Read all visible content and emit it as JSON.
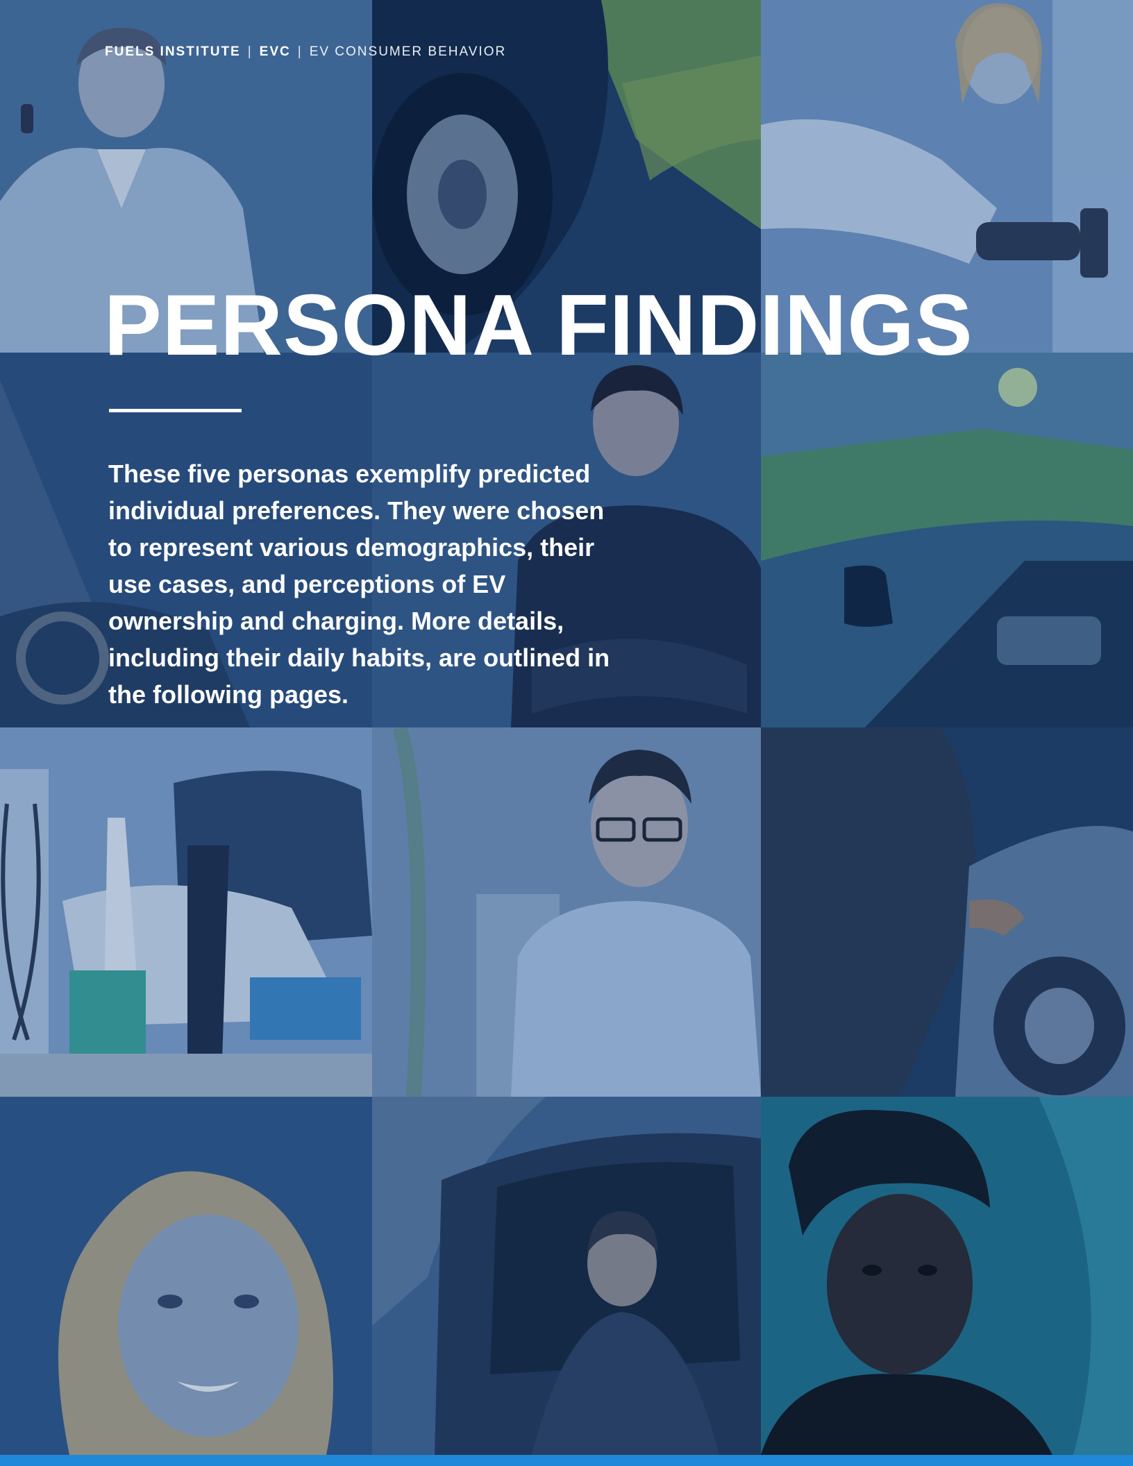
{
  "header": {
    "org": "FUELS INSTITUTE",
    "separator": "|",
    "program": "EVC",
    "section": "EV CONSUMER BEHAVIOR"
  },
  "title": "PERSONA FINDINGS",
  "intro": "These five personas exemplify predicted individual preferences. They were chosen to represent various demographics, their use cases, and perceptions of EV ownership and charging. More details, including their daily habits, are outlined in the following pages.",
  "colors": {
    "background": "#16365f",
    "text": "#ffffff",
    "accent_bar": "#1f88d9"
  },
  "photo_grid": [
    {
      "subject": "man on phone"
    },
    {
      "subject": "car driving"
    },
    {
      "subject": "woman charging EV"
    },
    {
      "subject": "steering wheel"
    },
    {
      "subject": "young man arms crossed"
    },
    {
      "subject": "road through windshield"
    },
    {
      "subject": "couple at charging station"
    },
    {
      "subject": "man with glasses"
    },
    {
      "subject": "hand plugging charger"
    },
    {
      "subject": "blonde woman smiling"
    },
    {
      "subject": "man in car on phone"
    },
    {
      "subject": "older woman with head wrap"
    }
  ]
}
